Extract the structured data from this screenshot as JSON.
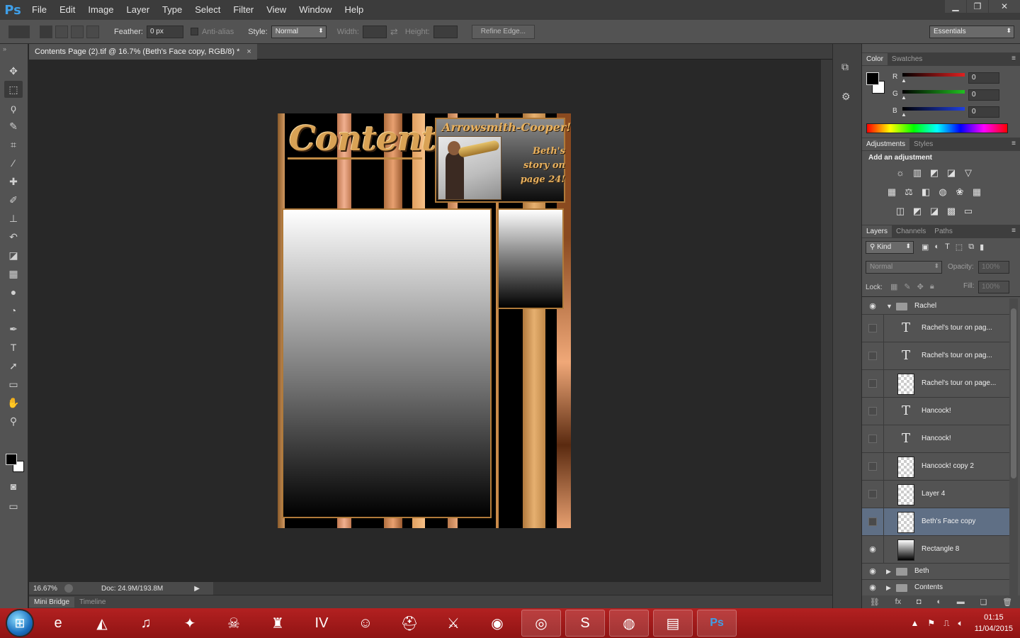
{
  "app": {
    "logo": "Ps",
    "menu": [
      "File",
      "Edit",
      "Image",
      "Layer",
      "Type",
      "Select",
      "Filter",
      "View",
      "Window",
      "Help"
    ],
    "window_controls": [
      "minimize",
      "restore",
      "close"
    ]
  },
  "options_bar": {
    "feather_label": "Feather:",
    "feather_value": "0 px",
    "antialias_label": "Anti-alias",
    "style_label": "Style:",
    "style_value": "Normal",
    "width_label": "Width:",
    "height_label": "Height:",
    "refine_edge_label": "Refine Edge...",
    "workspace_value": "Essentials"
  },
  "toolbar": {
    "tools": [
      {
        "name": "move-tool-icon",
        "glyph": "✥"
      },
      {
        "name": "marquee-tool-icon",
        "glyph": "⬚"
      },
      {
        "name": "lasso-tool-icon",
        "glyph": "ϙ"
      },
      {
        "name": "quick-select-tool-icon",
        "glyph": "✎"
      },
      {
        "name": "crop-tool-icon",
        "glyph": "⌗"
      },
      {
        "name": "eyedropper-tool-icon",
        "glyph": "⁄"
      },
      {
        "name": "healing-brush-tool-icon",
        "glyph": "✚"
      },
      {
        "name": "brush-tool-icon",
        "glyph": "✐"
      },
      {
        "name": "clone-stamp-tool-icon",
        "glyph": "⊥"
      },
      {
        "name": "history-brush-tool-icon",
        "glyph": "↶"
      },
      {
        "name": "eraser-tool-icon",
        "glyph": "◪"
      },
      {
        "name": "gradient-tool-icon",
        "glyph": "▦"
      },
      {
        "name": "blur-tool-icon",
        "glyph": "●"
      },
      {
        "name": "dodge-tool-icon",
        "glyph": "◔"
      },
      {
        "name": "pen-tool-icon",
        "glyph": "✒"
      },
      {
        "name": "type-tool-icon",
        "glyph": "T"
      },
      {
        "name": "path-selection-tool-icon",
        "glyph": "➚"
      },
      {
        "name": "rectangle-tool-icon",
        "glyph": "▭"
      },
      {
        "name": "hand-tool-icon",
        "glyph": "✋"
      },
      {
        "name": "zoom-tool-icon",
        "glyph": "⚲"
      }
    ]
  },
  "document": {
    "tab_title": "Contents Page (2).tif @ 16.7% (Beth's Face copy, RGB/8) *",
    "contents_title": "Contents",
    "hero_title": "Arrowsmith-Cooper!",
    "hero_caption": "Beth's story on page 24!",
    "zoom": "16.67%",
    "doc_info": "Doc: 24.9M/193.8M"
  },
  "bottom_tabs": [
    "Mini Bridge",
    "Timeline"
  ],
  "color_panel": {
    "tabs": [
      "Color",
      "Swatches"
    ],
    "channels": [
      {
        "label": "R",
        "value": "0",
        "color": "#e02020"
      },
      {
        "label": "G",
        "value": "0",
        "color": "#20c020"
      },
      {
        "label": "B",
        "value": "0",
        "color": "#2040e0"
      }
    ]
  },
  "adjustments_panel": {
    "tabs": [
      "Adjustments",
      "Styles"
    ],
    "heading": "Add an adjustment"
  },
  "layers_panel": {
    "tabs": [
      "Layers",
      "Channels",
      "Paths"
    ],
    "filter_kind": "Kind",
    "blend_mode": "Normal",
    "opacity_label": "Opacity:",
    "opacity_value": "100%",
    "lock_label": "Lock:",
    "fill_label": "Fill:",
    "fill_value": "100%",
    "group_open": "Rachel",
    "layers": [
      {
        "name": "Rachel's tour on pag...",
        "kind": "text",
        "visible": false,
        "selected": false
      },
      {
        "name": "Rachel's tour on pag...",
        "kind": "text",
        "visible": false,
        "selected": false
      },
      {
        "name": "Rachel's tour on page...",
        "kind": "raster",
        "visible": false,
        "selected": false
      },
      {
        "name": "Hancock!",
        "kind": "text",
        "visible": false,
        "selected": false
      },
      {
        "name": "Hancock!",
        "kind": "text",
        "visible": false,
        "selected": false
      },
      {
        "name": "Hancock! copy 2",
        "kind": "raster",
        "visible": false,
        "selected": false
      },
      {
        "name": "Layer 4",
        "kind": "raster",
        "visible": false,
        "selected": false
      },
      {
        "name": "Beth's Face copy",
        "kind": "raster",
        "visible": false,
        "selected": true
      },
      {
        "name": "Rectangle 8",
        "kind": "shape",
        "visible": true,
        "selected": false
      }
    ],
    "groups_closed": [
      "Beth",
      "Contents"
    ]
  },
  "taskbar": {
    "apps": [
      "internet-explorer-icon",
      "unity-icon",
      "itunes-icon",
      "game-icon-1",
      "game-icon-2",
      "game-icon-3",
      "gta-iv-icon",
      "fallout-icon",
      "halo-icon",
      "game-icon-4",
      "blender-icon",
      "chrome-icon",
      "skype-icon",
      "steam-icon",
      "file-explorer-icon",
      "photoshop-icon"
    ],
    "app_glyphs": [
      "e",
      "◭",
      "♫",
      "✦",
      "☠",
      "♜",
      "IV",
      "☺",
      "⛑",
      "⚔",
      "◉",
      "◎",
      "S",
      "◍",
      "▤",
      "Ps"
    ],
    "time": "01:15",
    "date": "11/04/2015"
  }
}
